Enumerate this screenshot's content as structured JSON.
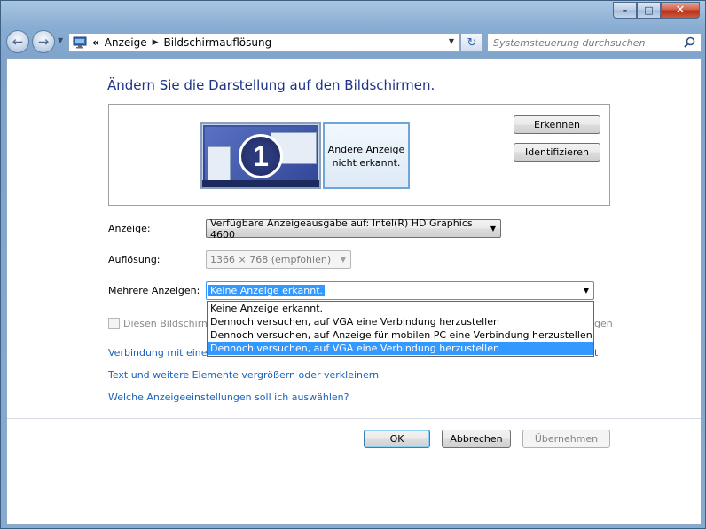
{
  "window": {
    "minimize_label": "–",
    "maximize_label": "□",
    "close_label": "✕"
  },
  "navbar": {
    "back_icon": "←",
    "forward_icon": "→",
    "history_dd_icon": "▼",
    "address_root_icon": "control-panel-icon",
    "address_prefix": "«",
    "breadcrumbs": [
      "Anzeige",
      "Bildschirmauflösung"
    ],
    "crumb_separator": "▶",
    "address_dd_icon": "▼",
    "refresh_icon": "↻",
    "search_placeholder": "Systemsteuerung durchsuchen",
    "search_icon": "🔍"
  },
  "main": {
    "title": "Ändern Sie die Darstellung auf den Bildschirmen.",
    "monitor_1_number": "1",
    "monitor_2_text": "Andere Anzeige nicht erkannt.",
    "detect_button": "Erkennen",
    "identify_button": "Identifizieren",
    "display_label": "Anzeige:",
    "display_value": "Verfügbare Anzeigeausgabe auf: Intel(R) HD Graphics 4600",
    "resolution_label": "Auflösung:",
    "resolution_value": "1366 × 768 (empfohlen)",
    "multiple_label": "Mehrere Anzeigen:",
    "multiple_value": "Keine Anzeige erkannt.",
    "multiple_options": [
      "Keine Anzeige erkannt.",
      "Dennoch versuchen, auf VGA eine Verbindung herzustellen",
      "Dennoch versuchen, auf Anzeige für mobilen PC eine Verbindung herzustellen",
      "Dennoch versuchen, auf VGA eine Verbindung herzustellen"
    ],
    "multiple_selected_index": 3,
    "checkbox_label_visible": "Diesen Bildschirm",
    "checkbox_right_fragment": "gen",
    "link_connection": "Verbindung mit einem",
    "link_connection_tail": "t",
    "link_text_size": "Text und weitere Elemente vergrößern oder verkleinern",
    "link_which_settings": "Welche Anzeigeeinstellungen soll ich auswählen?"
  },
  "footer": {
    "ok": "OK",
    "cancel": "Abbrechen",
    "apply": "Übernehmen"
  }
}
